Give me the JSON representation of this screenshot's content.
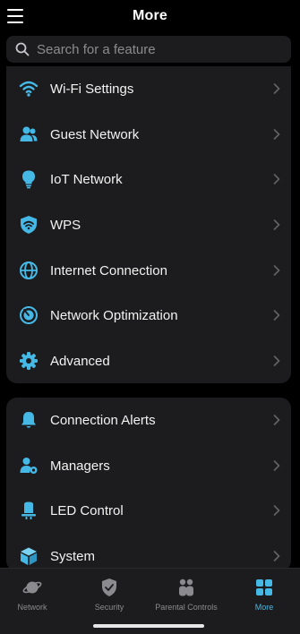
{
  "header": {
    "title": "More"
  },
  "search": {
    "placeholder": "Search for a feature"
  },
  "colors": {
    "accent": "#46b8e6",
    "card": "#1c1c1e",
    "background": "#000000",
    "chevron": "#636366"
  },
  "group1": [
    {
      "label": "Wi-Fi Settings",
      "icon": "wifi-icon"
    },
    {
      "label": "Guest Network",
      "icon": "guest-users-icon"
    },
    {
      "label": "IoT Network",
      "icon": "lightbulb-icon"
    },
    {
      "label": "WPS",
      "icon": "wps-shield-icon"
    },
    {
      "label": "Internet Connection",
      "icon": "globe-icon"
    },
    {
      "label": "Network Optimization",
      "icon": "optimization-gauge-icon"
    },
    {
      "label": "Advanced",
      "icon": "gear-icon"
    }
  ],
  "group2": [
    {
      "label": "Connection Alerts",
      "icon": "bell-icon"
    },
    {
      "label": "Managers",
      "icon": "user-gear-icon"
    },
    {
      "label": "LED Control",
      "icon": "led-lamp-icon"
    },
    {
      "label": "System",
      "icon": "cube-icon"
    }
  ],
  "tabs": [
    {
      "label": "Network",
      "icon": "planet-icon",
      "active": false
    },
    {
      "label": "Security",
      "icon": "shield-check-icon",
      "active": false
    },
    {
      "label": "Parental Controls",
      "icon": "family-icon",
      "active": false
    },
    {
      "label": "More",
      "icon": "grid-icon",
      "active": true
    }
  ]
}
